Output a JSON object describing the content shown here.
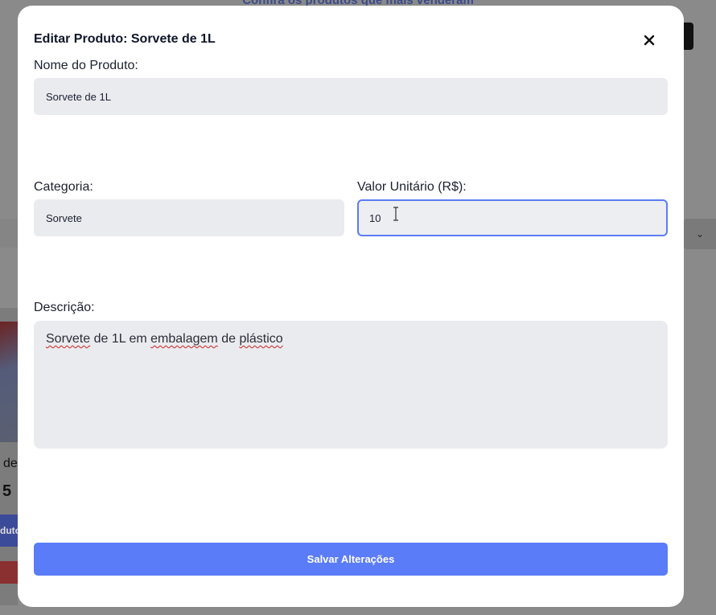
{
  "background": {
    "heading": "Confira os produtos que mais venderam",
    "card_text_1": "de",
    "card_text_2": "5",
    "card_button": "duto"
  },
  "modal": {
    "title": "Editar Produto: Sorvete de 1L",
    "close_icon": "close-icon",
    "name_label": "Nome do Produto:",
    "name_value": "Sorvete de 1L",
    "category_label": "Categoria:",
    "category_value": "Sorvete",
    "price_label": "Valor Unitário (R$):",
    "price_value": "10",
    "description_label": "Descrição:",
    "description_words": [
      "Sorvete",
      " de 1L em ",
      "embalagem",
      " de ",
      "plástico"
    ],
    "save_label": "Salvar Alterações"
  },
  "colors": {
    "accent": "#5b7cf8",
    "field_bg": "#eaebef",
    "focus_border": "#5b7cf4",
    "title": "#0f1629"
  }
}
